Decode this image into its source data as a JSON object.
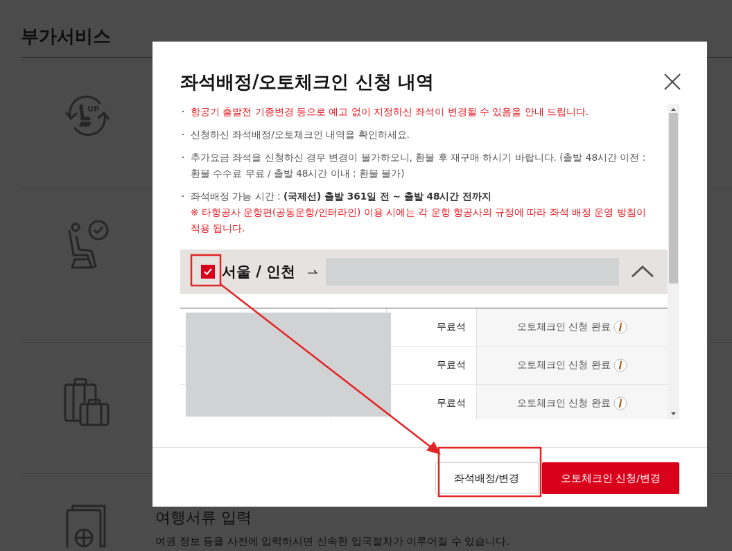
{
  "background": {
    "title": "부가서비스",
    "services": [
      {
        "kind": "upgrade",
        "icon_text": "UP"
      },
      {
        "kind": "seat"
      },
      {
        "kind": "baggage"
      },
      {
        "kind": "passport",
        "title": "여행서류 입력",
        "description": "여권 정보 등을 사전에 입력하시면 신속한 입국절차가 이루어질 수 있습니다."
      }
    ]
  },
  "dialog": {
    "title": "좌석배정/오토체크인 신청 내역",
    "notices": [
      {
        "text": "항공기 출발전 기종변경 등으로 예고 없이 지정하신 좌석이 변경될 수 있음을 안내 드립니다.",
        "warning": true
      },
      {
        "text": "신청하신 좌석배정/오토체크인 내역을 확인하세요.",
        "warning": false
      },
      {
        "text": "추가요금 좌석을 신청하신 경우 변경이 불가하오니, 환불 후 재구매 하시기 바랍니다. (출발 48시간 이전 : 환불 수수료 무료 / 출발 48시간 이내 : 환불 불가)",
        "warning": false
      },
      {
        "text": "좌석배정 가능 시간 : **(국제선) 출발 361일 전 ~ 출발 48시간 전까지**",
        "warning": false,
        "note": "※ 타항공사 운항편(공동운항/인터라인) 이용 시에는 각 운항 항공사의 규정에 따라 좌석 배정 운영 방침이 적용 됩니다."
      }
    ],
    "segment": {
      "route": "서울 / 인천",
      "checked": true,
      "expanded": true,
      "rows": [
        {
          "seat_type": "무료석",
          "status": "오토체크인 신청 완료"
        },
        {
          "seat_type": "무료석",
          "status": "오토체크인 신청 완료"
        },
        {
          "seat_type": "무료석",
          "status": "오토체크인 신청 완료"
        }
      ]
    },
    "buttons": [
      {
        "label": "좌석배정/변경",
        "kind": "secondary"
      },
      {
        "label": "오토체크인 신청/변경",
        "kind": "primary"
      }
    ]
  }
}
